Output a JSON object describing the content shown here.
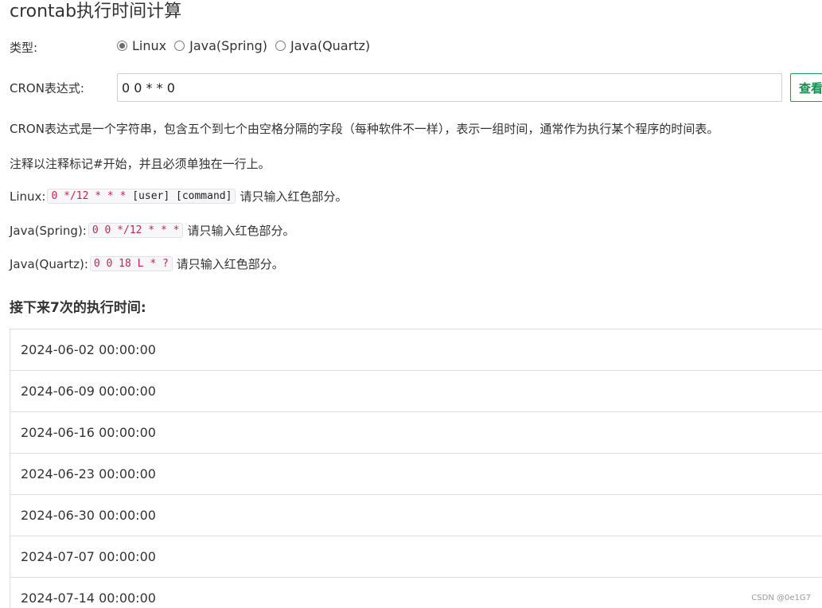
{
  "page": {
    "title": "crontab执行时间计算"
  },
  "form": {
    "type_label": "类型:",
    "type_options": [
      {
        "label": "Linux",
        "checked": true
      },
      {
        "label": "Java(Spring)",
        "checked": false
      },
      {
        "label": "Java(Quartz)",
        "checked": false
      }
    ],
    "cron_label": "CRON表达式:",
    "cron_value": "0 0 * * 0",
    "view_button": "查看"
  },
  "help": {
    "description": "CRON表达式是一个字符串，包含五个到七个由空格分隔的字段（每种软件不一样），表示一组时间，通常作为执行某个程序的时间表。",
    "comment_note": "注释以注释标记#开始，并且必须单独在一行上。",
    "linux_label": "Linux:",
    "linux_red": "0 */12 * * *",
    "linux_rest": " [user] [command]",
    "spring_label": "Java(Spring):",
    "spring_red": "0 0 */12 * * *",
    "quartz_label": "Java(Quartz):",
    "quartz_red": "0 0 18 L * ?",
    "hint": "请只输入红色部分。"
  },
  "results": {
    "title": "接下来7次的执行时间:",
    "items": [
      "2024-06-02 00:00:00",
      "2024-06-09 00:00:00",
      "2024-06-16 00:00:00",
      "2024-06-23 00:00:00",
      "2024-06-30 00:00:00",
      "2024-07-07 00:00:00",
      "2024-07-14 00:00:00"
    ]
  },
  "watermark": "CSDN @0e1G7"
}
